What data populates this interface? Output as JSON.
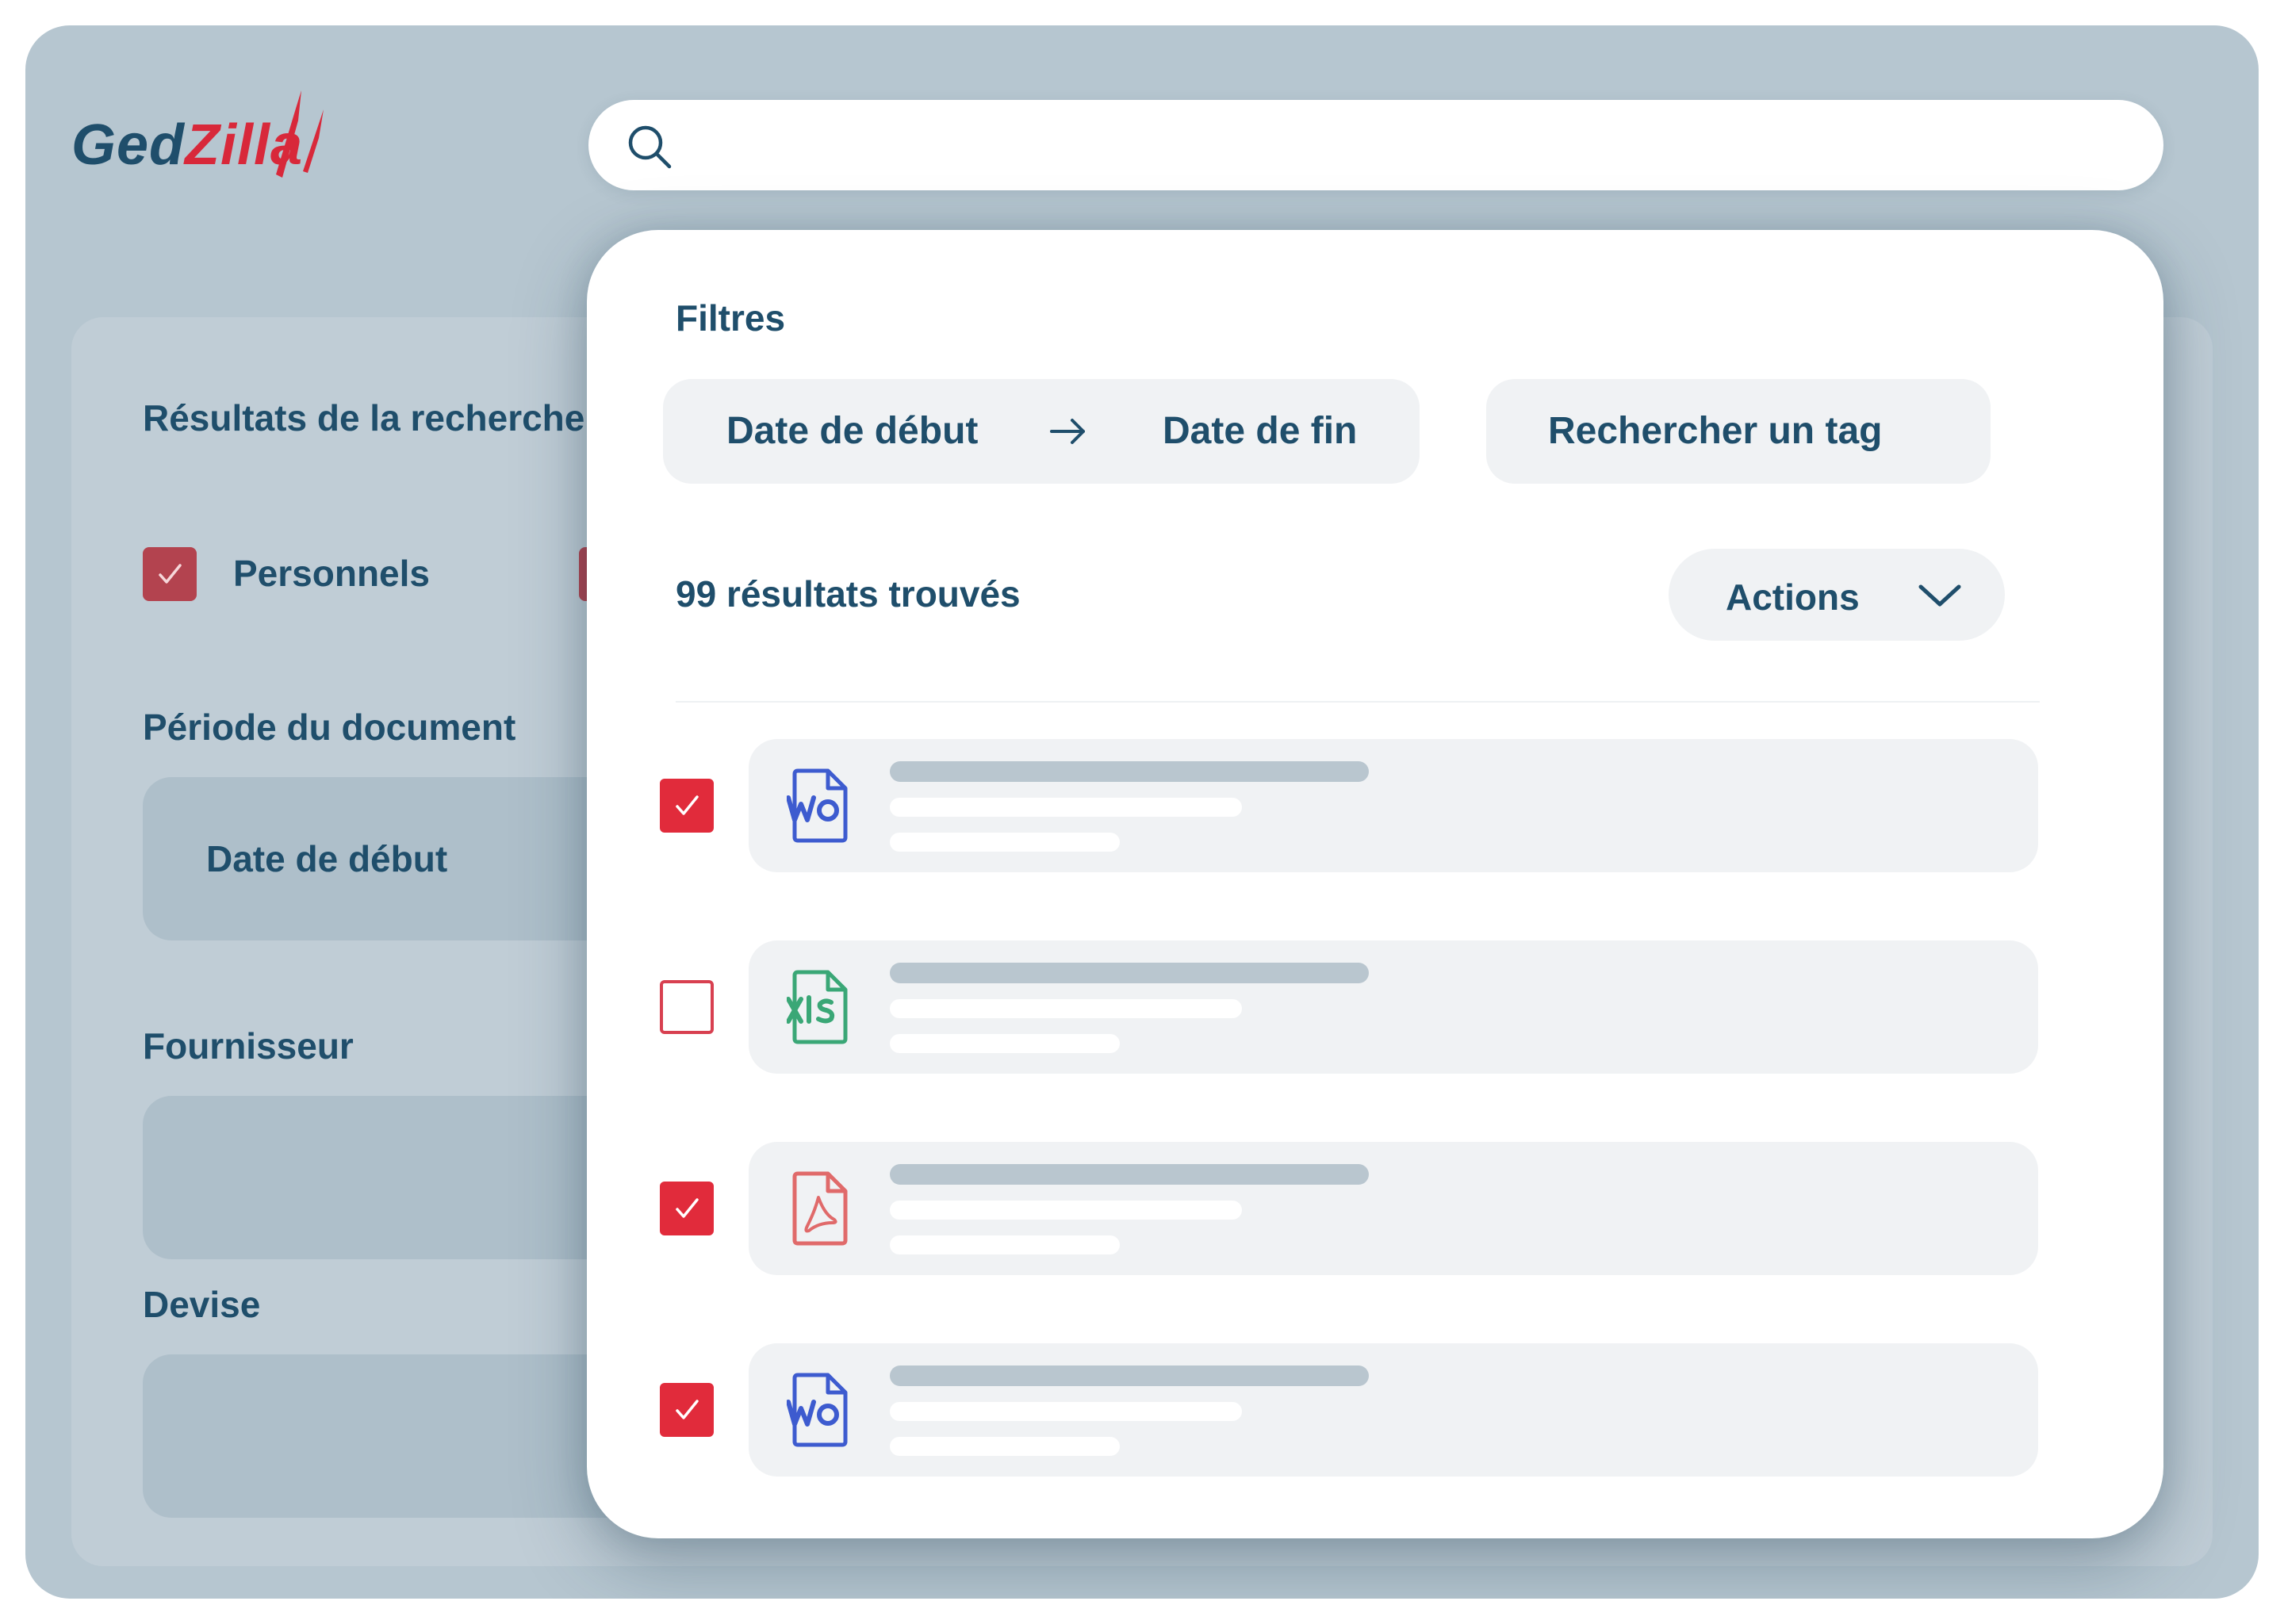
{
  "brand": {
    "logo_text_left": "Ged",
    "logo_text_right": "Zilla"
  },
  "colors": {
    "brand_navy": "#1f4e6b",
    "brand_red": "#d8283a",
    "check_red": "#e12b3b",
    "word_blue": "#3d5bcf",
    "excel_green": "#3aa776",
    "pdf_red": "#e06a6a"
  },
  "search": {
    "value": "",
    "placeholder": "",
    "icon": "search-icon"
  },
  "background": {
    "results_title": "Résultats de la recherche",
    "category_label": "Personnels",
    "period_label": "Période du document",
    "period_start": "Date de début",
    "supplier_label": "Fournisseur",
    "currency_label": "Devise"
  },
  "filters": {
    "title": "Filtres",
    "date_start": "Date de début",
    "date_end": "Date de fin",
    "tag_search": "Rechercher un tag"
  },
  "results": {
    "count_label": "99 résultats trouvés",
    "actions_label": "Actions",
    "items": [
      {
        "type": "word",
        "icon": "word-file-icon",
        "checked": true
      },
      {
        "type": "excel",
        "icon": "excel-file-icon",
        "checked": false
      },
      {
        "type": "pdf",
        "icon": "pdf-file-icon",
        "checked": true
      },
      {
        "type": "word",
        "icon": "word-file-icon",
        "checked": true
      }
    ]
  }
}
